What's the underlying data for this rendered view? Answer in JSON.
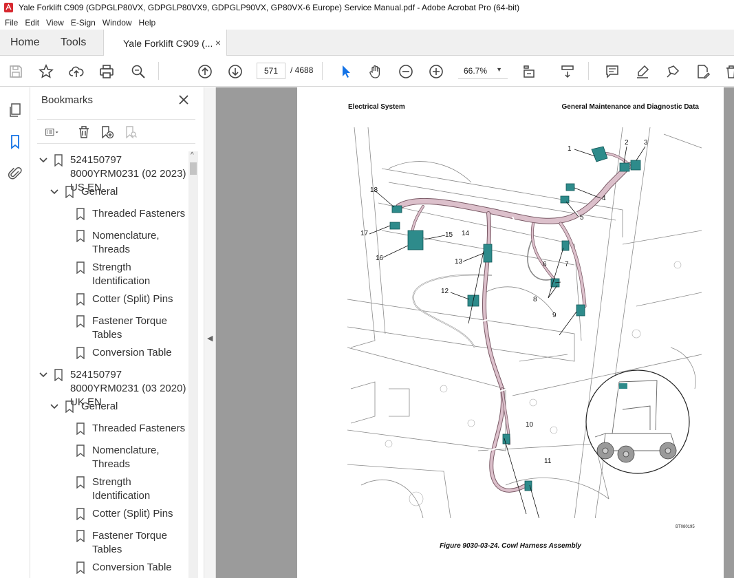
{
  "window": {
    "title": "Yale Forklift C909 (GDPGLP80VX, GDPGLP80VX9, GDPGLP90VX, GP80VX-6 Europe) Service Manual.pdf - Adobe Acrobat Pro (64-bit)"
  },
  "menu": {
    "items": [
      "File",
      "Edit",
      "View",
      "E-Sign",
      "Window",
      "Help"
    ]
  },
  "tabs": {
    "home": "Home",
    "tools": "Tools",
    "document": "Yale Forklift C909 (...",
    "close_symbol": "×"
  },
  "toolbar": {
    "current_page": "571",
    "page_total": "/ 4688",
    "zoom": "66.7%",
    "zoom_caret": "▼"
  },
  "bookmarks": {
    "title": "Bookmarks",
    "items": [
      {
        "label": "524150797 8000YRM0231 (02 2023) US EN",
        "level": 0
      },
      {
        "label": "General",
        "level": 1
      },
      {
        "label": "Threaded Fasteners",
        "level": 2
      },
      {
        "label": "Nomenclature, Threads",
        "level": 2
      },
      {
        "label": "Strength Identification",
        "level": 2
      },
      {
        "label": "Cotter (Split) Pins",
        "level": 2
      },
      {
        "label": "Fastener Torque Tables",
        "level": 2
      },
      {
        "label": "Conversion Table",
        "level": 2
      },
      {
        "label": "524150797 8000YRM0231 (03 2020) UK EN",
        "level": 0
      },
      {
        "label": "General",
        "level": 1
      },
      {
        "label": "Threaded Fasteners",
        "level": 2
      },
      {
        "label": "Nomenclature, Threads",
        "level": 2
      },
      {
        "label": "Strength Identification",
        "level": 2
      },
      {
        "label": "Cotter (Split) Pins",
        "level": 2
      },
      {
        "label": "Fastener Torque Tables",
        "level": 2
      },
      {
        "label": "Conversion Table",
        "level": 2
      }
    ]
  },
  "page": {
    "header_left": "Electrical System",
    "header_right": "General Maintenance and Diagnostic Data",
    "figure_code": "BT080195",
    "caption": "Figure 9030-03-24. Cowl Harness Assembly",
    "callouts": [
      "1",
      "2",
      "3",
      "4",
      "5",
      "6",
      "7",
      "8",
      "9",
      "10",
      "11",
      "12",
      "13",
      "14",
      "15",
      "16",
      "17",
      "18"
    ]
  },
  "colors": {
    "accent": "#1473e6",
    "harness": "#d9b8c4",
    "connector": "#2e8b8b"
  }
}
